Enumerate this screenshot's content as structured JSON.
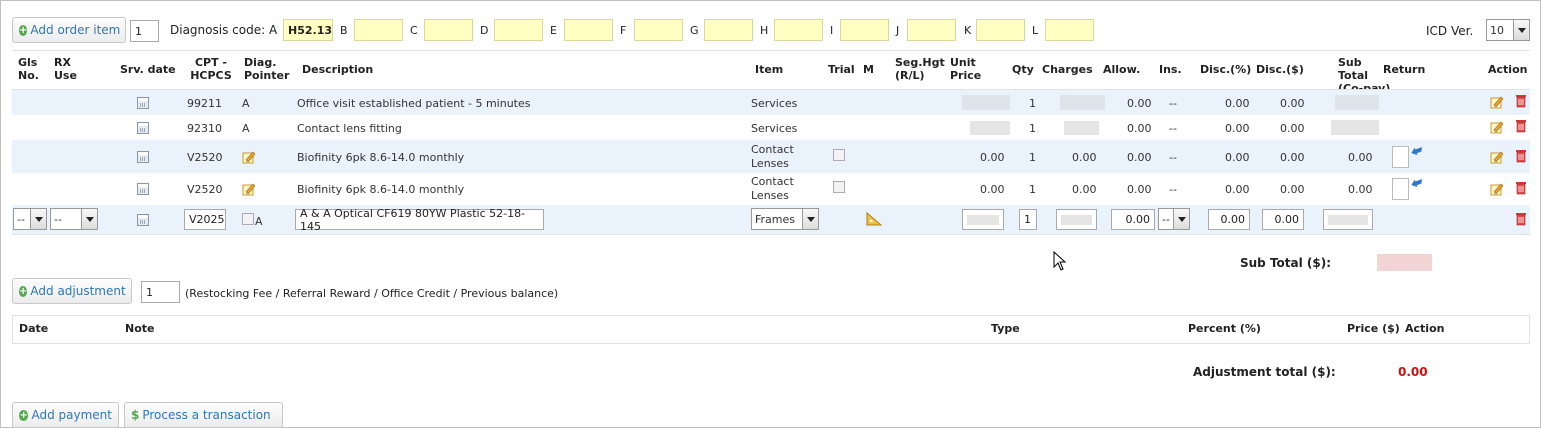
{
  "toolbar": {
    "add_order_item_label": "Add order item",
    "order_item_qty": "1",
    "diagnosis_label": "Diagnosis code: A",
    "diag_codes": [
      {
        "letter": "A",
        "value": "H52.13"
      },
      {
        "letter": "B",
        "value": ""
      },
      {
        "letter": "C",
        "value": ""
      },
      {
        "letter": "D",
        "value": ""
      },
      {
        "letter": "E",
        "value": ""
      },
      {
        "letter": "F",
        "value": ""
      },
      {
        "letter": "G",
        "value": ""
      },
      {
        "letter": "H",
        "value": ""
      },
      {
        "letter": "I",
        "value": ""
      },
      {
        "letter": "J",
        "value": ""
      },
      {
        "letter": "K",
        "value": ""
      },
      {
        "letter": "L",
        "value": ""
      }
    ],
    "icd_label": "ICD Ver.",
    "icd_value": "10"
  },
  "table": {
    "headers": {
      "gls": "Gls No.",
      "rx": "RX Use",
      "srv": "Srv. date",
      "cpt": "CPT - HCPCS",
      "diag": "Diag. Pointer",
      "desc": "Description",
      "item": "Item",
      "trial": "Trial",
      "m": "M",
      "seg": "Seg.Hgt (R/L)",
      "unit": "Unit Price",
      "qty": "Qty",
      "charges": "Charges",
      "allow": "Allow.",
      "ins": "Ins.",
      "discp": "Disc.(%)",
      "discd": "Disc.($)",
      "subtotal": "Sub Total (Co-pay)",
      "ret": "Return",
      "action": "Action"
    },
    "rows": [
      {
        "cpt": "99211",
        "diag": "A",
        "desc": "Office visit established patient - 5 minutes",
        "item": "Services",
        "qty": "1",
        "allow": "0.00",
        "ins": "--",
        "discp": "0.00",
        "discd": "0.00"
      },
      {
        "cpt": "92310",
        "diag": "A",
        "desc": "Contact lens fitting",
        "item": "Services",
        "qty": "1",
        "allow": "0.00",
        "ins": "--",
        "discp": "0.00",
        "discd": "0.00"
      },
      {
        "cpt": "V2520",
        "diag": "",
        "desc": "Biofinity 6pk 8.6-14.0 monthly",
        "item": "Contact Lenses",
        "unit": "0.00",
        "qty": "1",
        "charges": "0.00",
        "allow": "0.00",
        "ins": "--",
        "discp": "0.00",
        "discd": "0.00",
        "subtotal": "0.00"
      },
      {
        "cpt": "V2520",
        "diag": "",
        "desc": "Biofinity 6pk 8.6-14.0 monthly",
        "item": "Contact Lenses",
        "unit": "0.00",
        "qty": "1",
        "charges": "0.00",
        "allow": "0.00",
        "ins": "--",
        "discp": "0.00",
        "discd": "0.00",
        "subtotal": "0.00"
      }
    ],
    "edit_row": {
      "gls": "--",
      "rx": "--",
      "cpt": "V2025",
      "diag": "A",
      "desc": "A & A Optical CF619 80YW Plastic 52-18-145",
      "item": "Frames",
      "qty": "1",
      "allow": "0.00",
      "ins": "--",
      "discp": "0.00",
      "discd": "0.00"
    },
    "subtotal_label": "Sub Total ($):"
  },
  "adjustment": {
    "add_label": "Add adjustment",
    "qty": "1",
    "hint": "(Restocking Fee / Referral Reward / Office Credit / Previous balance)",
    "headers": {
      "date": "Date",
      "note": "Note",
      "type": "Type",
      "percent": "Percent (%)",
      "price": "Price ($)",
      "action": "Action"
    },
    "total_label": "Adjustment total ($):",
    "total_value": "0.00"
  },
  "payment": {
    "add_payment_label": "Add payment",
    "process_label": "Process a transaction"
  },
  "colors": {
    "accent": "#2f77b5",
    "row_alt": "#eaf3fb",
    "total_red": "#cc1111"
  }
}
